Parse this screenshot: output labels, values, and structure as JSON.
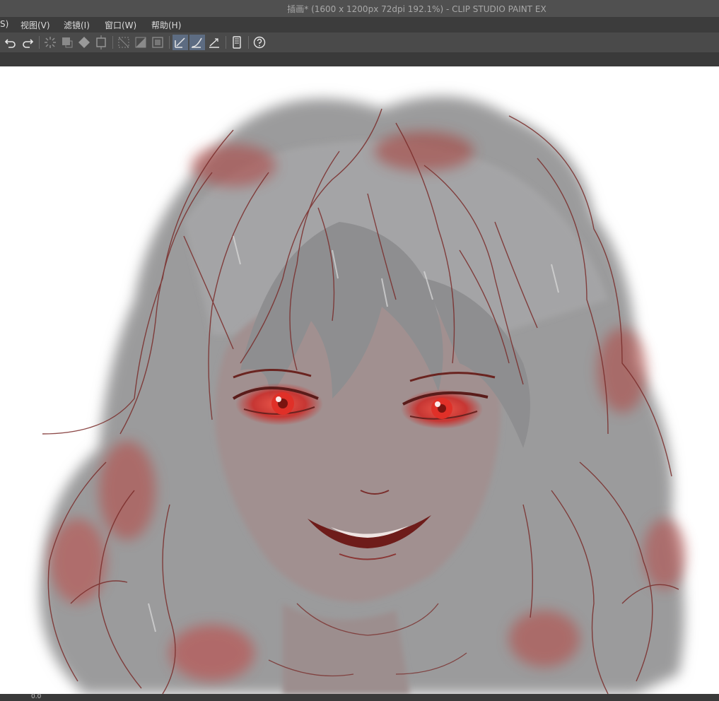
{
  "window": {
    "title": "插画* (1600 x 1200px 72dpi 192.1%)  - CLIP STUDIO PAINT EX"
  },
  "menu": {
    "items": [
      {
        "label": "S)"
      },
      {
        "label": "视图(V)"
      },
      {
        "label": "滤镜(I)"
      },
      {
        "label": "窗口(W)"
      },
      {
        "label": "帮助(H)"
      }
    ]
  },
  "toolbar": {
    "buttons": [
      {
        "name": "undo-icon"
      },
      {
        "name": "redo-icon"
      },
      {
        "name": "loading-icon"
      },
      {
        "name": "selection-icon"
      },
      {
        "name": "fill-icon"
      },
      {
        "name": "transform-icon"
      },
      {
        "name": "clear-selection-icon"
      },
      {
        "name": "invert-selection-icon"
      },
      {
        "name": "border-icon"
      },
      {
        "name": "snap-ruler-icon"
      },
      {
        "name": "snap-special-ruler-icon"
      },
      {
        "name": "snap-grid-icon"
      },
      {
        "name": "tablet-icon"
      },
      {
        "name": "help-icon"
      }
    ]
  },
  "status": {
    "zoom_text": "0.0"
  },
  "colors": {
    "titlebar": "#505050",
    "menubar": "#3c3c3c",
    "toolbar": "#4a4a4a",
    "active_button": "#5d6c82",
    "line_art": "#8a2e2c",
    "highlight": "#e02a2a",
    "canvas": "#ffffff"
  },
  "canvas": {
    "subject": "illustration-of-girl-with-wavy-gray-hair-and-red-eyes"
  }
}
